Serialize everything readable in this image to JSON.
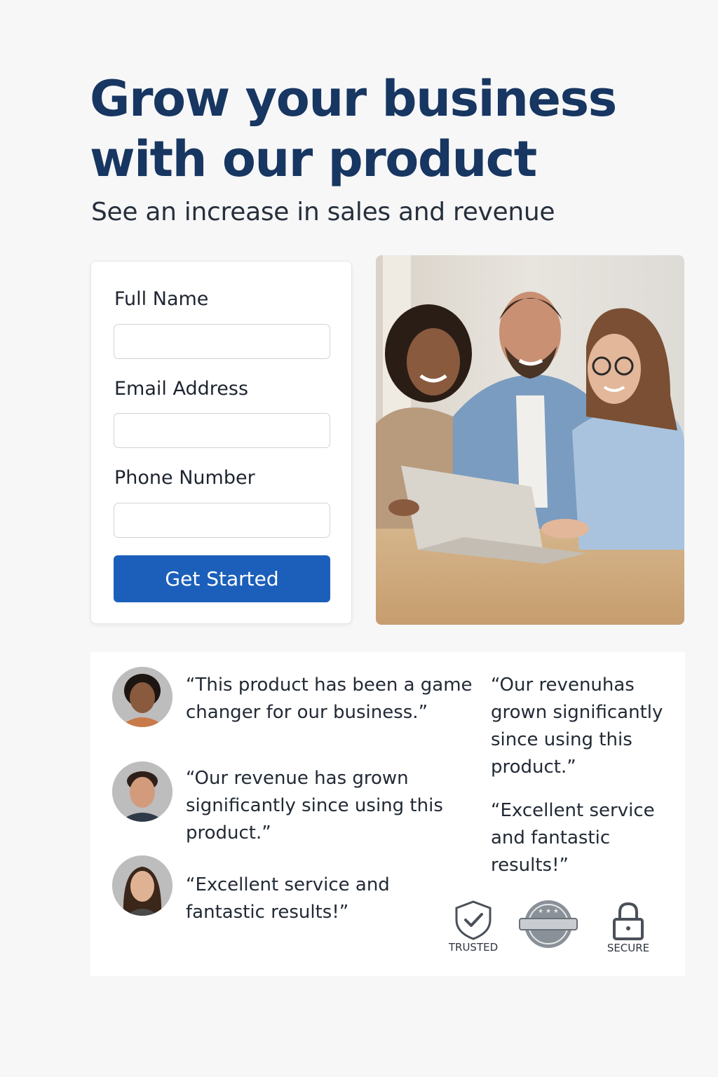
{
  "hero": {
    "title": "Grow your business with our product",
    "subtitle": "See an increase in sales and revenue"
  },
  "form": {
    "fields": [
      {
        "label": "Full Name",
        "value": "",
        "placeholder": ""
      },
      {
        "label": "Email Address",
        "value": "",
        "placeholder": ""
      },
      {
        "label": "Phone Number",
        "value": "",
        "placeholder": ""
      }
    ],
    "submit_label": "Get Started"
  },
  "photo": {
    "icon": "team-with-laptop-photo"
  },
  "testimonials": {
    "left": [
      {
        "avatar": "woman-curly-hair-avatar",
        "quote": "“This product has been a game changer for our business.”"
      },
      {
        "avatar": "man-smiling-avatar",
        "quote": "“Our revenue has grown significantly since using this product.”"
      },
      {
        "avatar": "woman-long-hair-avatar",
        "quote": "“Excellent service and fantastic results!”"
      }
    ],
    "right": [
      {
        "quote": "“Our revenuhas grown significantly since using this product.”"
      },
      {
        "quote": "“Excellent service and fantastic results!”"
      }
    ]
  },
  "badges": [
    {
      "icon": "shield-check-icon",
      "label": "TRUSTED"
    },
    {
      "icon": "seal-icon",
      "label": ""
    },
    {
      "icon": "padlock-icon",
      "label": "SECURE"
    }
  ],
  "colors": {
    "title": "#173661",
    "button": "#1c5fba",
    "background": "#f7f7f8"
  }
}
